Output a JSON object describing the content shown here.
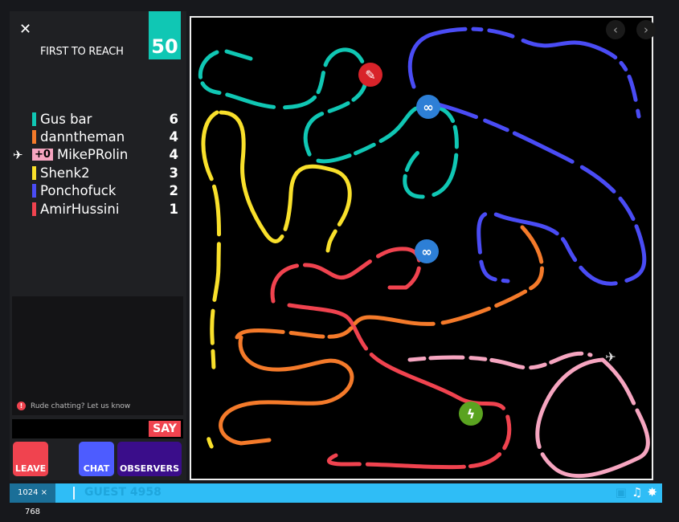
{
  "header": {
    "close_icon": "close-icon",
    "first_to_reach_label": "FIRST TO REACH",
    "target_score": "50"
  },
  "players": [
    {
      "name": "Gus bar",
      "score": "6",
      "color": "#10c7b4"
    },
    {
      "name": "danntheman",
      "score": "4",
      "color": "#f47a2a"
    },
    {
      "name": "MikePRolin",
      "score": "4",
      "color": "#f6a5c0",
      "badge": "+0",
      "is_self": true
    },
    {
      "name": "Shenk2",
      "score": "3",
      "color": "#f9e02b"
    },
    {
      "name": "Ponchofuck",
      "score": "2",
      "color": "#4a4cf5"
    },
    {
      "name": "AmirHussini",
      "score": "1",
      "color": "#f0434f"
    }
  ],
  "chat": {
    "notice": "Rude chatting? Let us know",
    "input_value": "",
    "say_label": "SAY"
  },
  "buttons": {
    "leave": "LEAVE",
    "chat": "CHAT",
    "observers": "OBSERVERS"
  },
  "footer": {
    "resolution": "1024 × 768",
    "guest_name": "GUEST 4958"
  },
  "powerups": [
    "swap-icon",
    "multi-icon",
    "multi-icon",
    "speed-icon"
  ]
}
